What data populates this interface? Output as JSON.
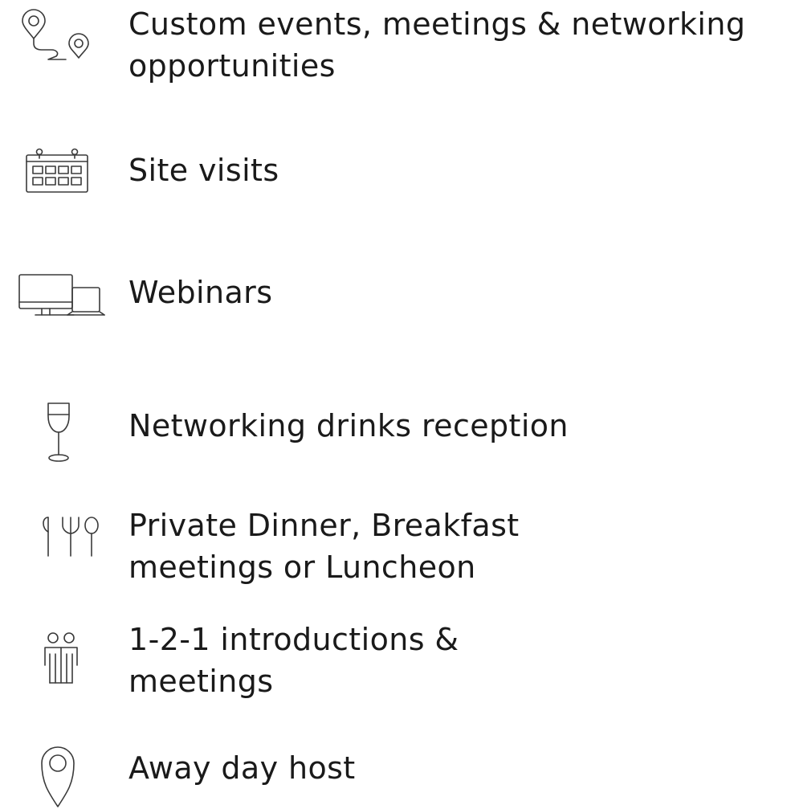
{
  "items": [
    {
      "icon": "route-map-pin-icon",
      "line1": "Custom events, meetings & networking",
      "line2": "opportunities"
    },
    {
      "icon": "calendar-icon",
      "line1": "Site visits",
      "line2": ""
    },
    {
      "icon": "desktop-laptop-icon",
      "line1": "Webinars",
      "line2": ""
    },
    {
      "icon": "wine-glass-icon",
      "line1": "Networking drinks reception",
      "line2": ""
    },
    {
      "icon": "cutlery-icon",
      "line1": "Private Dinner, Breakfast",
      "line2": "meetings or Luncheon"
    },
    {
      "icon": "people-icon",
      "line1": "1-2-1 introductions &",
      "line2": "meetings"
    },
    {
      "icon": "location-pin-icon",
      "line1": "Away day host",
      "line2": ""
    }
  ],
  "colors": {
    "text": "#1a1a1a",
    "icon_stroke": "#3a3a3a",
    "background": "#ffffff"
  }
}
